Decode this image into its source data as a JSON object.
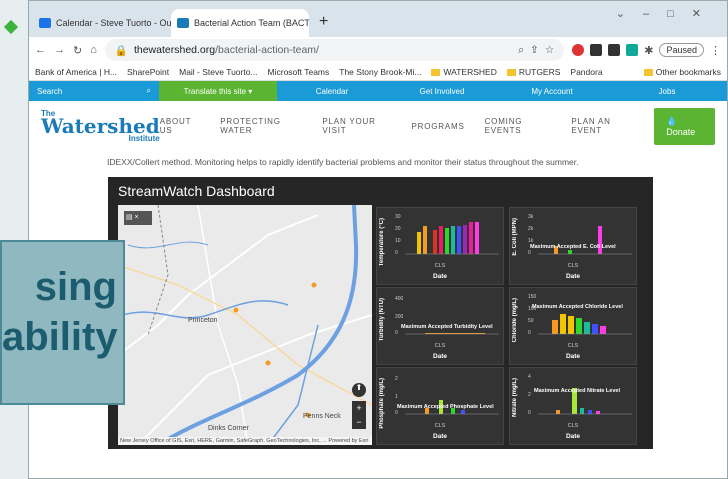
{
  "browser": {
    "tabs": [
      {
        "label": "Calendar - Steve Tuorto - Outlo"
      },
      {
        "label": "Bacterial Action Team (BACT) | Th"
      }
    ],
    "url_domain": "thewatershed.org",
    "url_path": "/bacterial-action-team/",
    "paused": "Paused",
    "bookmarks": [
      "Bank of America | H...",
      "SharePoint",
      "Mail - Steve Tuorto...",
      "Microsoft Teams",
      "The Stony Brook-Mi...",
      "WATERSHED",
      "RUTGERS",
      "Pandora"
    ],
    "other_bookmarks": "Other bookmarks"
  },
  "site": {
    "topbar": {
      "search": "Search",
      "translate": "Translate this site",
      "calendar": "Calendar",
      "involved": "Get Involved",
      "account": "My Account",
      "jobs": "Jobs"
    },
    "logo": {
      "the": "The",
      "name": "Watershed",
      "inst": "Institute"
    },
    "nav": [
      "ABOUT US",
      "PROTECTING WATER",
      "PLAN YOUR VISIT",
      "PROGRAMS",
      "COMING EVENTS",
      "PLAN AN EVENT"
    ],
    "donate": "Donate",
    "paragraph": "IDEXX/Collert method. Monitoring helps to rapidly identify bacterial problems and monitor their status throughout the summer."
  },
  "dashboard": {
    "title": "StreamWatch Dashboard",
    "map": {
      "labels": [
        "Princeton",
        "Penns Neck",
        "Dinks Corner"
      ],
      "credit": "New Jersey Office of GIS, Esri, HERE, Garmin, SafeGraph, GeoTechnologies, Inc, ... Powered by Esri"
    },
    "panels": [
      {
        "ylabel": "Temperature (°C)",
        "ticks": [
          "30",
          "20",
          "10",
          "0"
        ],
        "ref": "",
        "cls": "CLS",
        "xlabel": "Date"
      },
      {
        "ylabel": "E. Coli (MPN)",
        "ticks": [
          "3k",
          "2k",
          "1k",
          "0"
        ],
        "ref": "Maximum Accepted E. Coli Level",
        "cls": "CLS",
        "xlabel": "Date"
      },
      {
        "ylabel": "Turbidity (NTU)",
        "ticks": [
          "400",
          "200",
          "0"
        ],
        "ref": "Maximum Accepted Turbidity Level",
        "cls": "CLS",
        "xlabel": "Date"
      },
      {
        "ylabel": "Chloride (mg/L)",
        "ticks": [
          "150",
          "100",
          "50",
          "0"
        ],
        "ref": "Maximum Accepted Chloride Level",
        "cls": "CLS",
        "xlabel": "Date"
      },
      {
        "ylabel": "Phosphate (mg/L)",
        "ticks": [
          "2",
          "1",
          "0"
        ],
        "ref": "Maximum Accepted Phosphate Level",
        "cls": "CLS",
        "xlabel": "Date"
      },
      {
        "ylabel": "Nitrate (mg/L)",
        "ticks": [
          "4",
          "2",
          "0"
        ],
        "ref": "Maximum Accepted Nitrate Level",
        "cls": "CLS",
        "xlabel": "Date"
      }
    ]
  },
  "overlay": {
    "line1": "sing",
    "line2": "ability"
  },
  "colors": {
    "topbar_blue": "#1a9ad6",
    "topbar_green": "#5bb532",
    "brand": "#1b7ab8",
    "dash_bg": "#262626"
  }
}
